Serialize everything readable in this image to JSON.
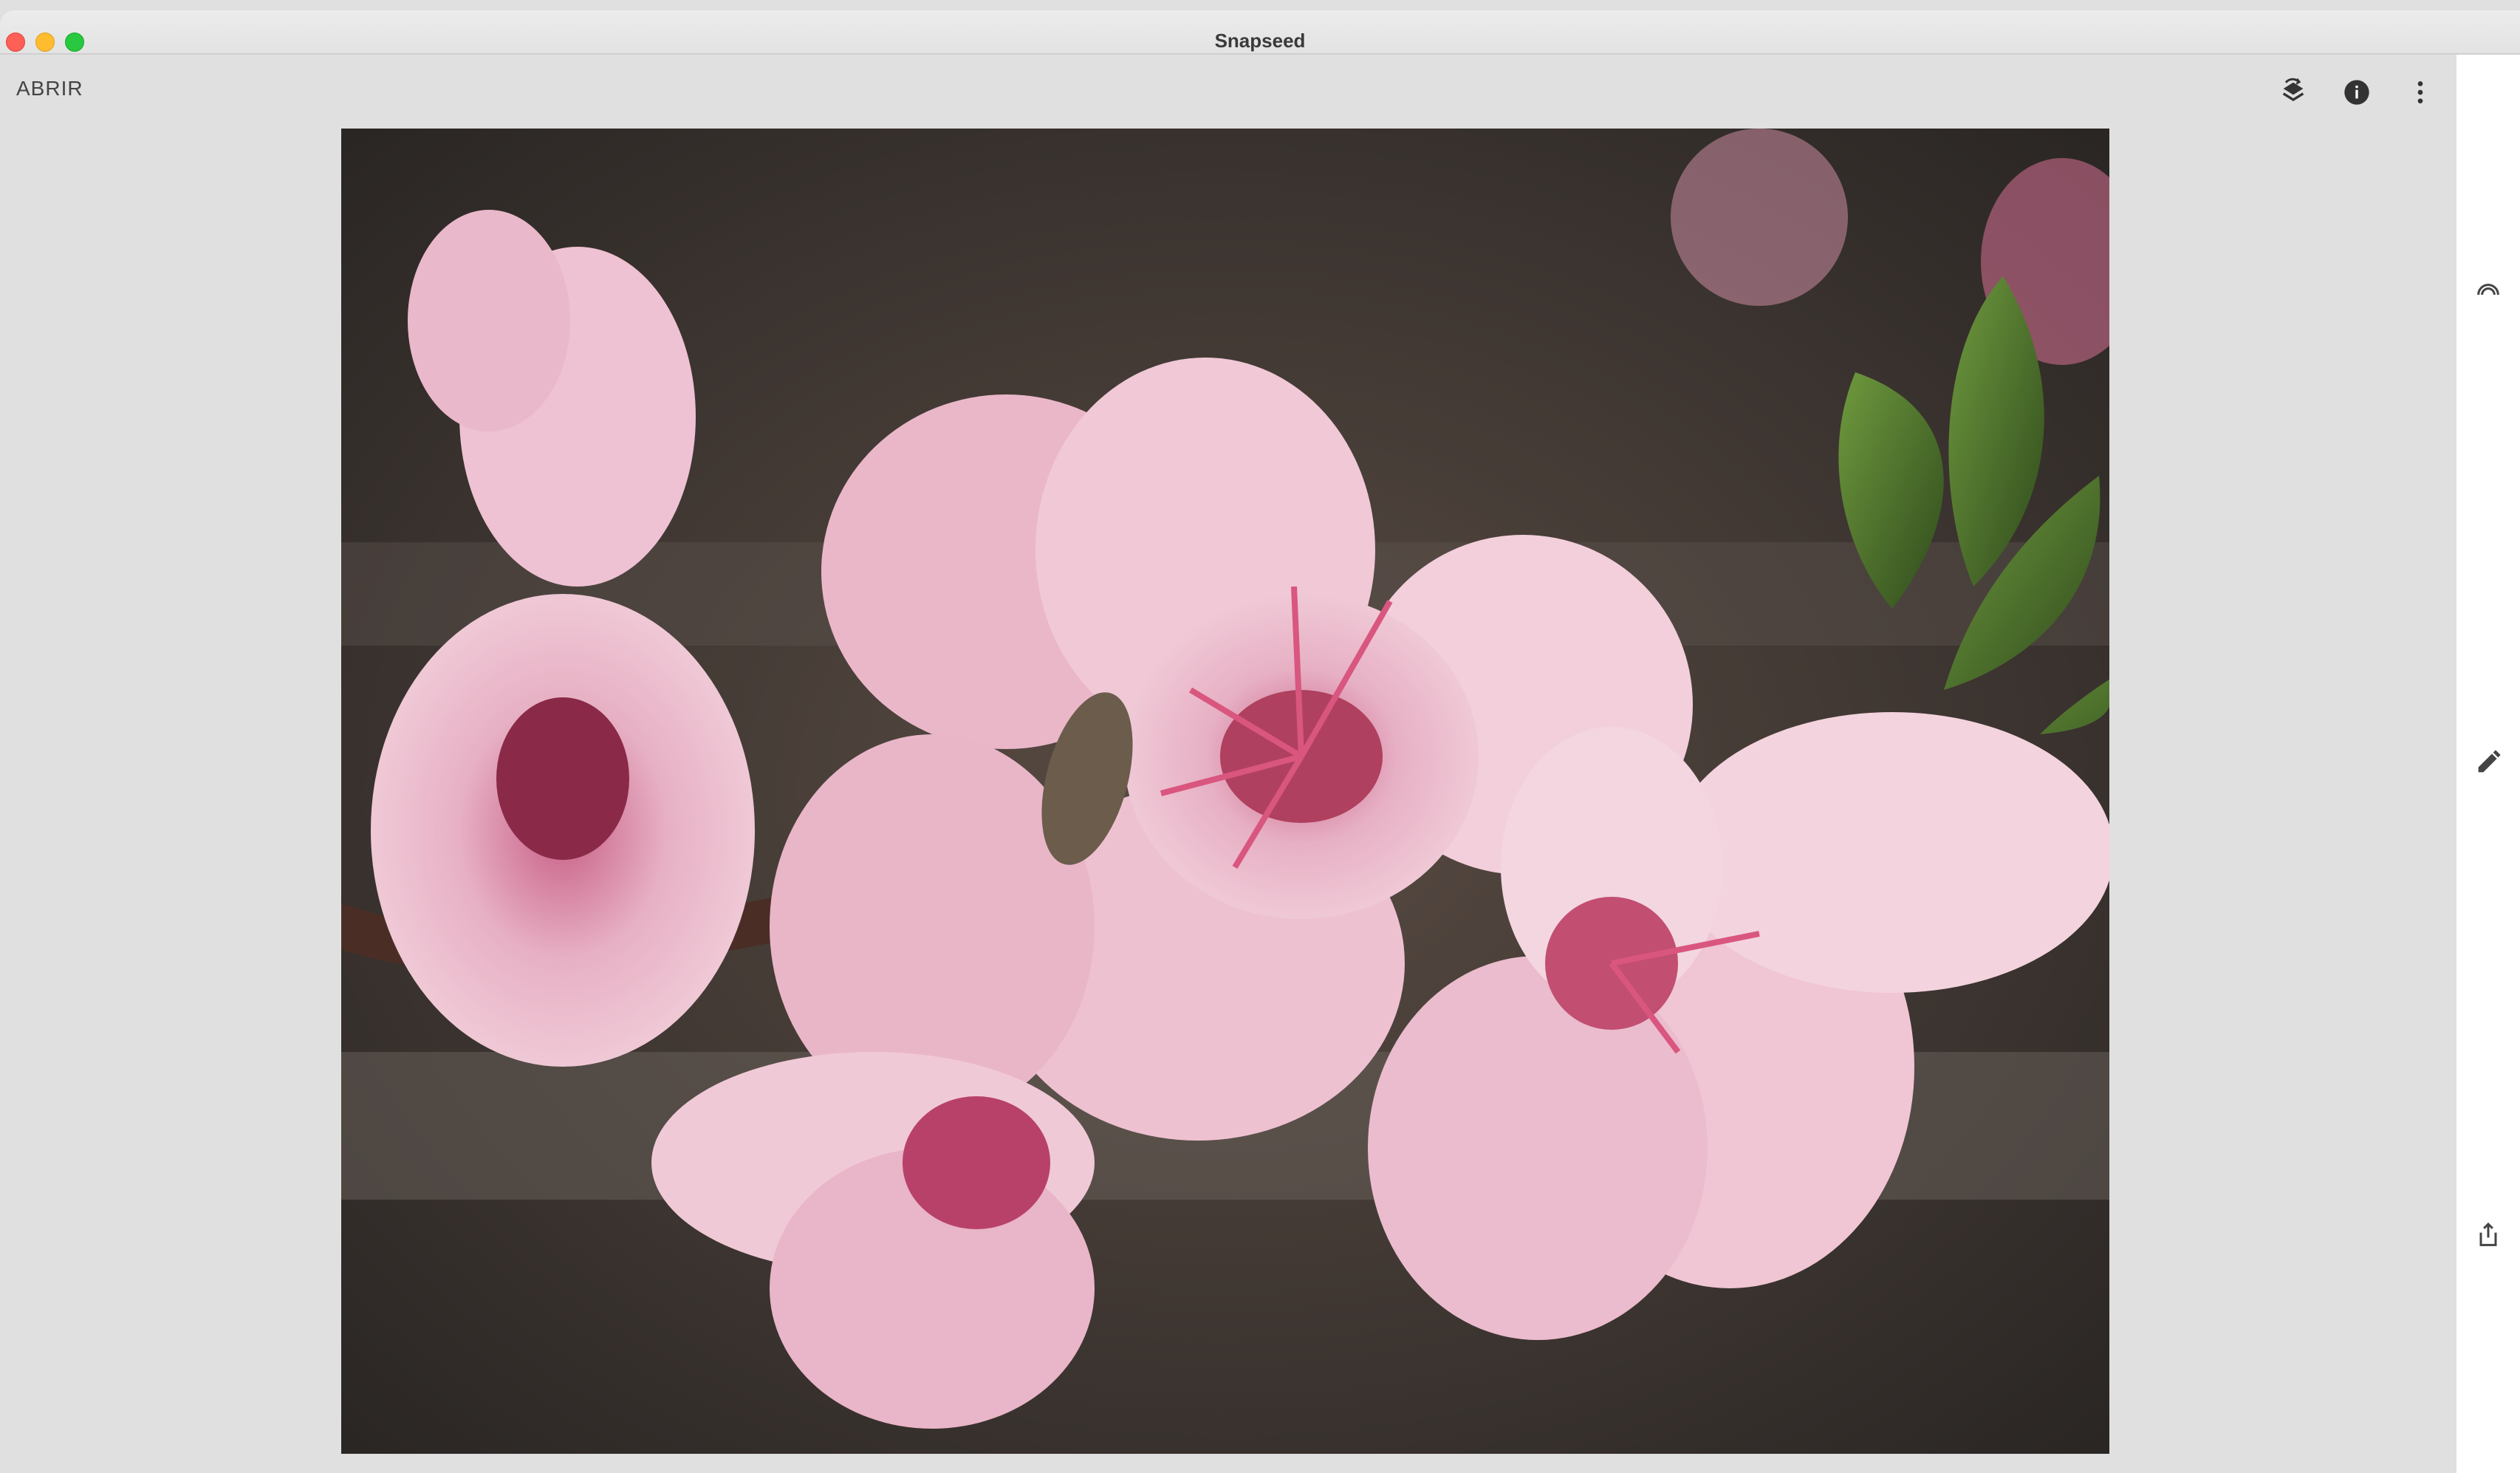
{
  "window": {
    "title": "Snapseed"
  },
  "toolbar": {
    "open_label": "ABRIR",
    "icons": [
      "undo-layers-icon",
      "info-icon",
      "more-vert-icon"
    ]
  },
  "sidebar": {
    "icons": [
      "looks-icon",
      "tools-pencil-icon",
      "export-share-icon"
    ]
  },
  "image": {
    "subject": "",
    "colors": {
      "petal": "#e7b4c6",
      "petal_light": "#f4d6e1",
      "leaf": "#557a32",
      "background": "#3b3532"
    }
  }
}
